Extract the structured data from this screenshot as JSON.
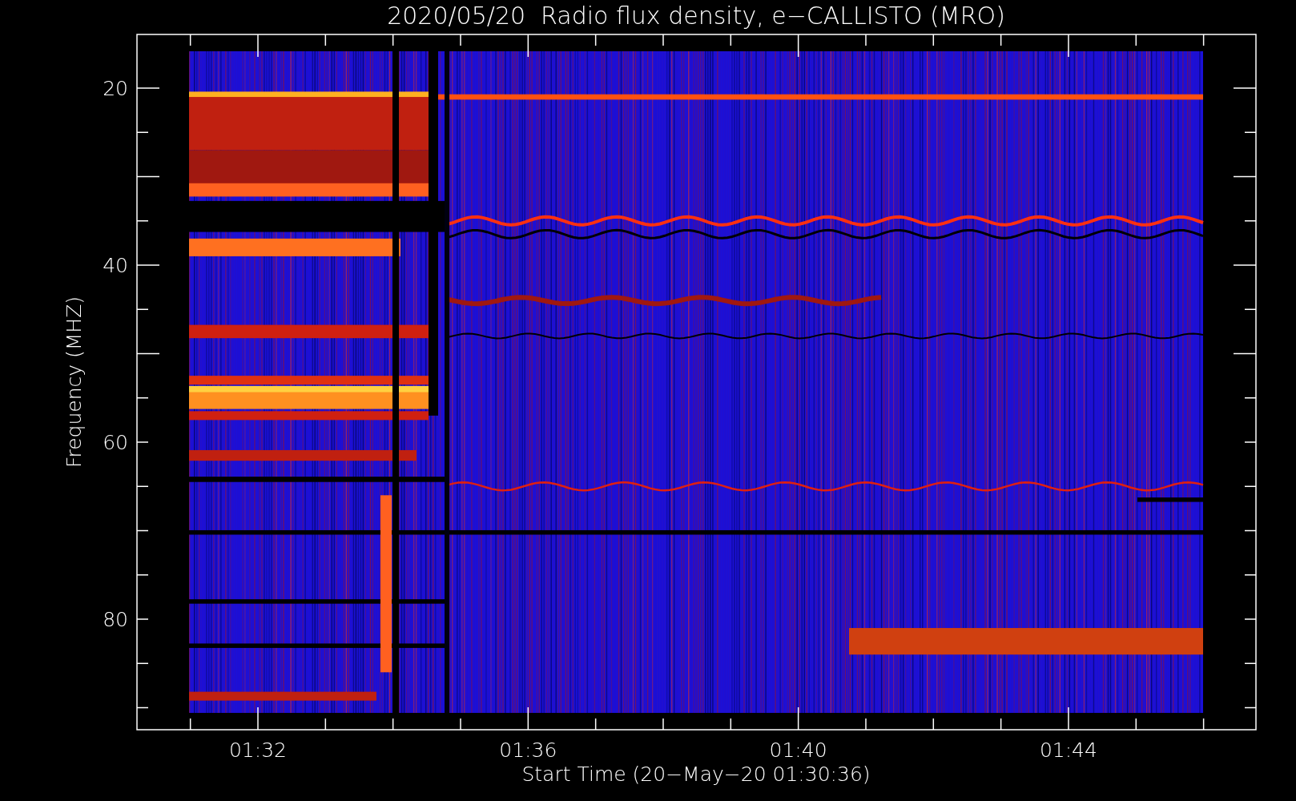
{
  "title": "2020/05/20  Radio flux density, e−CALLISTO (MRO)",
  "y_axis": {
    "label": "Frequency (MHZ)",
    "ticks": [
      "20",
      "40",
      "60",
      "80"
    ]
  },
  "x_axis": {
    "label": "Start Time (20−May−20 01:30:36)",
    "ticks": [
      "01:32",
      "01:36",
      "01:40",
      "01:44"
    ]
  }
}
